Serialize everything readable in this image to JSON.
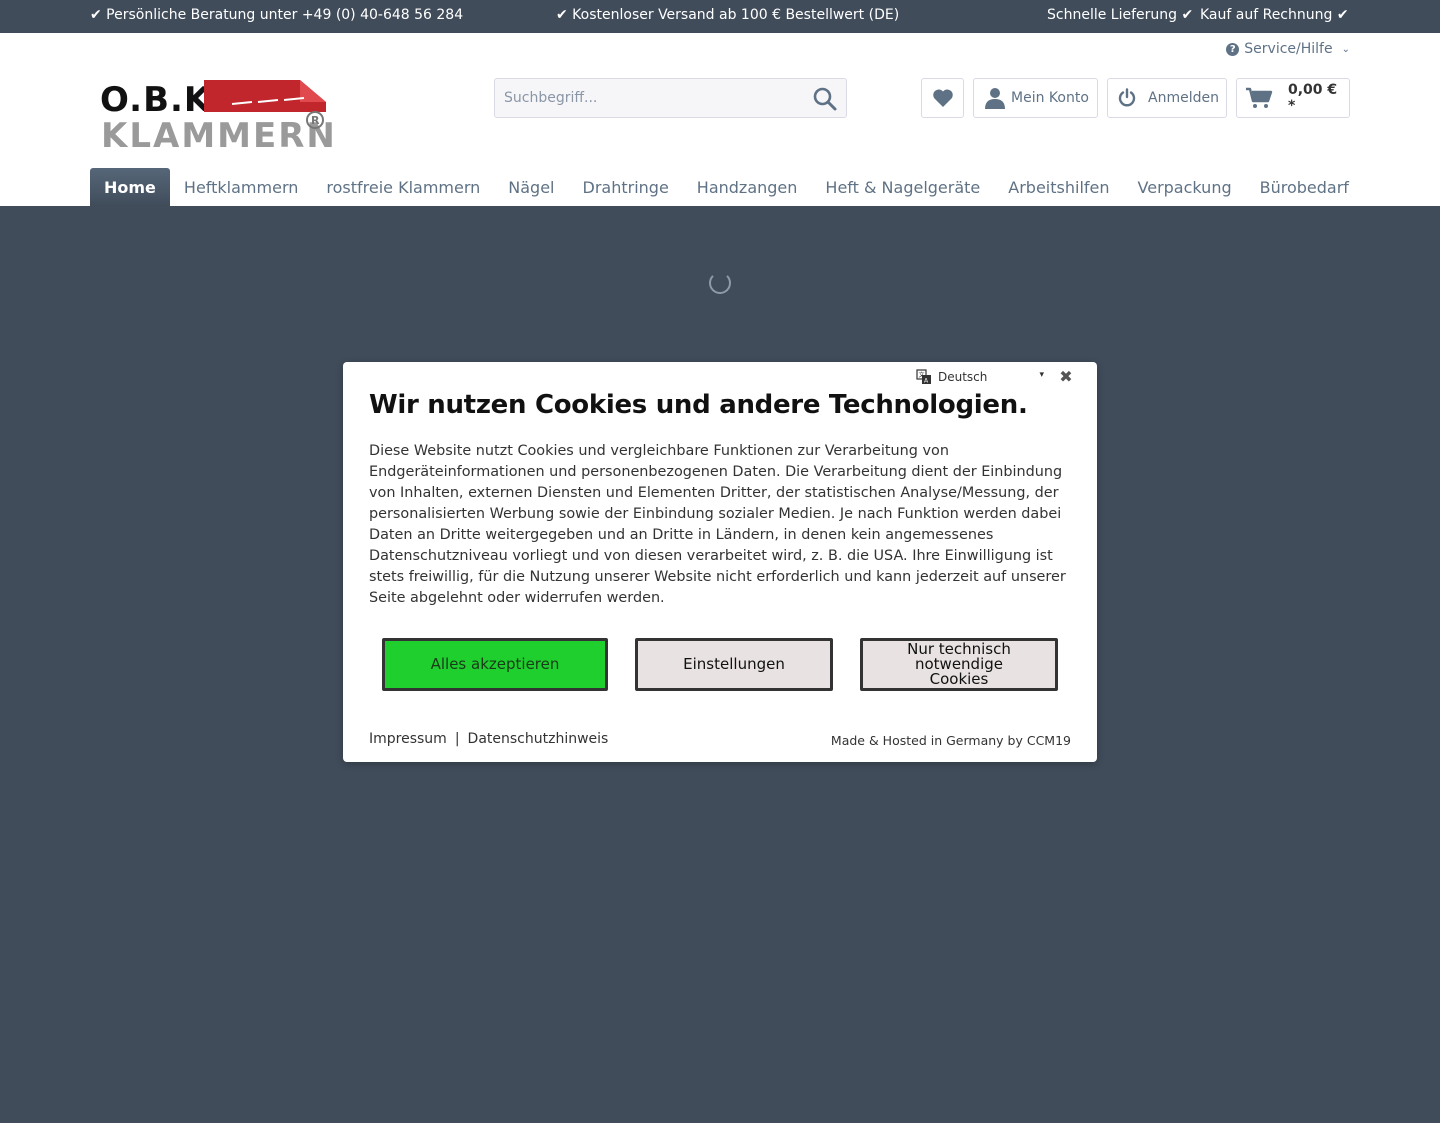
{
  "topbar": {
    "left": "✔ Persönliche Beratung unter +49 (0) 40-648 56 284",
    "center": "✔ Kostenloser Versand ab 100 € Bestellwert (DE)",
    "right1": "Schnelle Lieferung ✔",
    "right2": "Kauf auf Rechnung ✔"
  },
  "header": {
    "service_label": "Service/Hilfe",
    "logo_line1": "O.B.K.",
    "logo_line2": "KLAMMERN",
    "search_placeholder": "Suchbegriff...",
    "account_label": "Mein Konto",
    "login_label": "Anmelden",
    "cart_label": "0,00 € *"
  },
  "nav": {
    "items": [
      "Home",
      "Heftklammern",
      "rostfreie Klammern",
      "Nägel",
      "Drahtringe",
      "Handzangen",
      "Heft & Nagelgeräte",
      "Arbeitshilfen",
      "Verpackung",
      "Bürobedarf"
    ]
  },
  "cookie": {
    "language": "Deutsch",
    "title": "Wir nutzen Cookies und andere Technologien.",
    "text": "Diese Website nutzt Cookies und vergleichbare Funktionen zur Verarbeitung von Endgeräteinformationen und personenbezogenen Daten. Die Verarbeitung dient der Einbindung von Inhalten, externen Diensten und Elementen Dritter, der statistischen Analyse/Messung, der personalisierten Werbung sowie der Einbindung sozialer Medien. Je nach Funktion werden dabei Daten an Dritte weitergegeben und an Dritte in Ländern, in denen kein angemessenes Datenschutzniveau vorliegt und von diesen verarbeitet wird, z. B. die USA. Ihre Einwilligung ist stets freiwillig, für die Nutzung unserer Website nicht erforderlich und kann jederzeit auf unserer Seite abgelehnt oder widerrufen werden.",
    "accept_all": "Alles akzeptieren",
    "settings": "Einstellungen",
    "technical_only": "Nur technisch notwendige Cookies",
    "imprint": "Impressum",
    "separator": "|",
    "privacy": "Datenschutzhinweis",
    "made_by": "Made & Hosted in Germany by CCM19"
  },
  "colors": {
    "dark_slate": "#404c5a",
    "link_grey": "#5f7285",
    "accept_green": "#1ecf2e",
    "logo_red": "#c0262b"
  }
}
